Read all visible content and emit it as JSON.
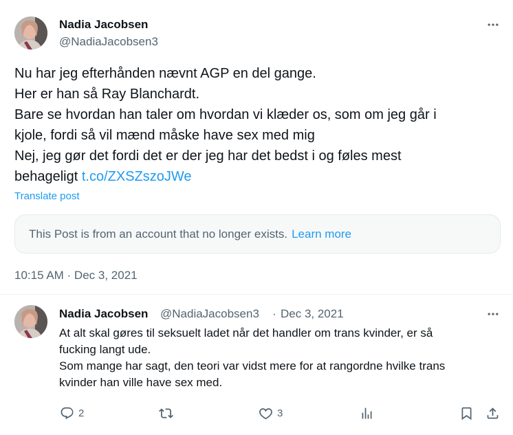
{
  "main_post": {
    "author_name": "Nadia Jacobsen",
    "author_handle": "@NadiaJacobsen3",
    "lines": [
      "Nu har jeg efterhånden nævnt AGP en del gange.",
      "Her er han så Ray Blanchardt.",
      "Bare se hvordan han taler om hvordan vi klæder os, som om jeg går i",
      "kjole, fordi så vil mænd måske have sex med mig",
      "Nej, jeg gør det fordi det er der jeg har det bedst i og føles mest",
      "behageligt"
    ],
    "link_text": "t.co/ZXSZszoJWe",
    "translate_label": "Translate post",
    "notice_text": "This Post is from an account that no longer exists.",
    "notice_link": "Learn more",
    "timestamp": "10:15 AM · Dec 3, 2021"
  },
  "reply": {
    "author_name": "Nadia Jacobsen",
    "author_handle": "@NadiaJacobsen3",
    "separator": "·",
    "date": "Dec 3, 2021",
    "lines": [
      "At alt skal gøres til seksuelt ladet når det handler om trans kvinder, er så",
      "fucking langt ude.",
      "Som mange har sagt, den teori var vidst mere for at rangordne hvilke trans",
      "kvinder han ville have sex med."
    ],
    "actions": {
      "reply_count": "2",
      "retweet_count": "",
      "like_count": "3"
    }
  },
  "icons": {
    "more": "more-horizontal-icon",
    "reply": "comment-bubble-icon",
    "retweet": "retweet-icon",
    "like": "heart-icon",
    "views": "bar-chart-icon",
    "bookmark": "bookmark-icon",
    "share": "share-upload-icon"
  },
  "colors": {
    "accent": "#1d9bf0",
    "text": "#0f1419",
    "secondary": "#536471",
    "border": "#eff3f4"
  }
}
